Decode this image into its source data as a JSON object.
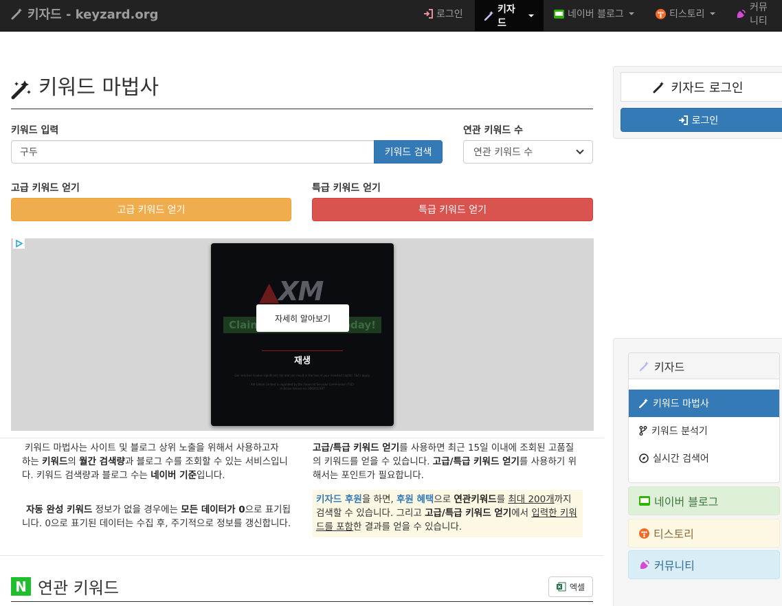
{
  "navbar": {
    "brand": "키자드 - keyzard.org",
    "items": [
      {
        "label": "로그인"
      },
      {
        "label": "키자드"
      },
      {
        "label": "네이버 블로그"
      },
      {
        "label": "티스토리"
      },
      {
        "label": "커뮤니티"
      }
    ]
  },
  "main": {
    "title": "키워드 마법사",
    "keyword_label": "키워드 입력",
    "keyword_value": "구두",
    "search_button": "키워드 검색",
    "related_count_label": "연관 키워드 수",
    "related_count_selected": "연관 키워드 수",
    "premium_label": "고급 키워드 얻기",
    "premium_button": "고급 키워드 얻기",
    "special_label": "특급 키워드 얻기",
    "special_button": "특급 키워드 얻기"
  },
  "ad": {
    "logo": "XM",
    "claim_left": "Claim",
    "claim_right": "oday!",
    "learn_more": "자세히 알아보기",
    "play": "재생",
    "fine1": "Our services involve significant risk and can result in the loss of your invested capital. T&Cs apply.",
    "fine2": "XM Global Limited is regulated by the Financial Services Commission (FSC)",
    "fine3": "in Belize license no. 000261/397"
  },
  "description": {
    "p1": {
      "t1": "키워드 마법사는 사이트 및 블로그 상위 노출을 위해서 사용하고자 하는 ",
      "b1": "키워드",
      "t2": "의 ",
      "b2": "월간 검색량",
      "t3": "과 블로그 수를 조회할 수 있는 서비스입니다.  키워드 검색량과 블로그 수는 ",
      "b3": "네이버 기준",
      "t4": "입니다."
    },
    "p2": {
      "b1": "자동 완성 키워드",
      "t1": " 정보가 없을 경우에는 ",
      "b2": "모든 데이터가 0",
      "t2": "으로 표기됩니다. 0으로 표기된 데이터는 수집 후, 주기적으로 정보를 갱신합니다."
    },
    "p3": {
      "b1": "고급/특급 키워드 얻기",
      "t1": "를 사용하면 최근 15일 이내에 조회된 고품질의 키워드를 얻을 수 있습니다. ",
      "b2": "고급/특급 키워드 얻기",
      "t2": "를 사용하기 위해서는 포인트가 필요합니다."
    },
    "p4": {
      "h1": "키자드 후원",
      "t1": "을 하면, ",
      "h2": "후원 혜택",
      "t2": "으로 ",
      "b1": "연관키워드",
      "t3": "를 ",
      "u1": "최대 200개",
      "t4": "까지 검색할 수 있습니다. 그리고 ",
      "b2": "고급/특급 키워드 얻기",
      "t5": "에서 ",
      "u2": "입력한 키워드를 포함",
      "t6": "한 결과를 얻을 수 있습니다."
    }
  },
  "related_section": {
    "badge": "N",
    "title": "연관 키워드",
    "excel_button": "엑셀"
  },
  "sidebar": {
    "login_title": "키자드 로그인",
    "login_button": "로그인",
    "keyzard_panel": "키자드",
    "menu": [
      {
        "label": "키워드 마법사"
      },
      {
        "label": "키워드 분석기"
      },
      {
        "label": "실시간 검색어"
      }
    ],
    "naver_blog": "네이버 블로그",
    "tistory": "티스토리",
    "community": "커뮤니티"
  },
  "colors": {
    "primary": "#337ab7",
    "warning": "#f0ad4e",
    "danger": "#d9534f",
    "navbar": "#222222",
    "naver_green": "#1fbf2c"
  }
}
